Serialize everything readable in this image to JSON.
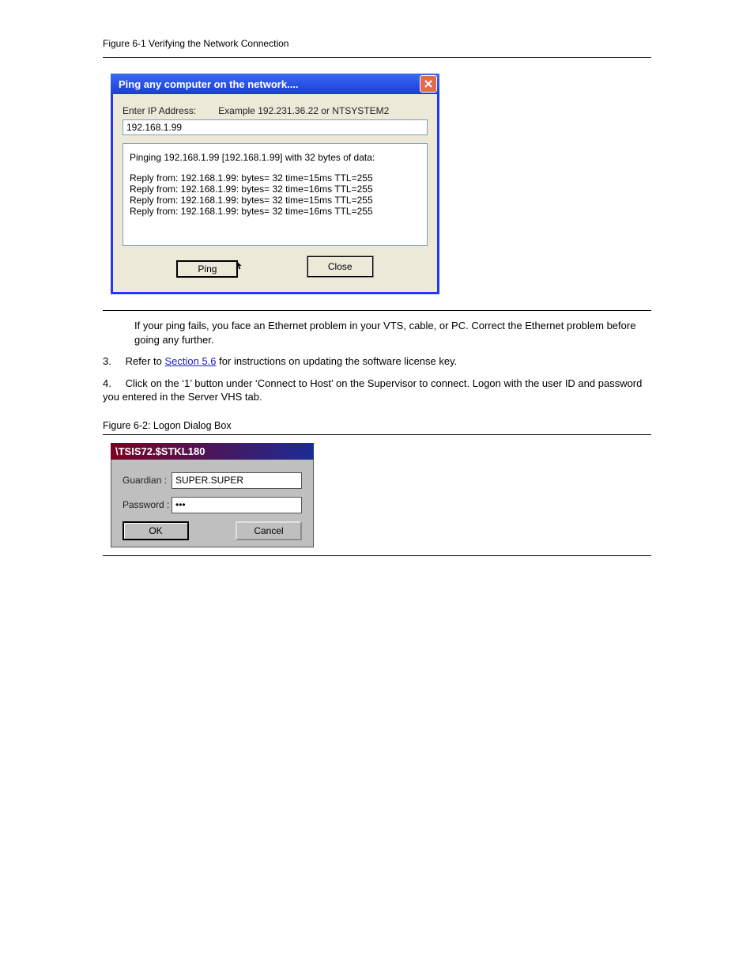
{
  "fig_ping_caption": "Figure 6-1 Verifying the Network Connection",
  "ping": {
    "title": "Ping any computer on the network....",
    "label_enter": "Enter IP Address:",
    "label_example": "Example 192.231.36.22  or  NTSYSTEM2",
    "ip_value": "192.168.1.99",
    "out_header": "Pinging 192.168.1.99 [192.168.1.99] with 32 bytes of data:",
    "out_lines": [
      "Reply from: 192.168.1.99: bytes= 32 time=15ms TTL=255",
      "Reply from: 192.168.1.99: bytes= 32 time=16ms TTL=255",
      "Reply from: 192.168.1.99: bytes= 32 time=15ms TTL=255",
      "Reply from: 192.168.1.99: bytes= 32 time=16ms TTL=255"
    ],
    "btn_ping": "Ping",
    "btn_close": "Close"
  },
  "followup_text": "If your ping fails, you face an Ethernet problem in your VTS, cable, or PC. Correct the Ethernet problem before going any further.",
  "step3": {
    "num": "3.",
    "text_before": "Refer to ",
    "link": "Section 5.6",
    "text_after": " for instructions on updating the software license key."
  },
  "step4": {
    "num": "4.",
    "text": "Click on the ‘1’ button under ‘Connect to Host’ on the Supervisor to connect. Logon with the user ID and password you entered in the Server VHS tab."
  },
  "fig_logon_label": "Figure 6-2: Logon Dialog Box",
  "login": {
    "title": "\\TSIS72.$STKL180",
    "lbl_guardian": "Guardian :",
    "lbl_password": "Password :",
    "guardian_value": "SUPER.SUPER",
    "password_value": "•••",
    "btn_ok": "OK",
    "btn_cancel": "Cancel"
  }
}
